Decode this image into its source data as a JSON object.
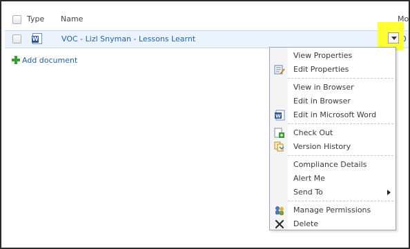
{
  "header": {
    "type_label": "Type",
    "name_label": "Name",
    "modified_label": "Mo"
  },
  "row": {
    "name": "VOC - Lizl Snyman - Lessons Learnt",
    "modified": ":0"
  },
  "add_document": "Add document",
  "accent": "#1f64a5",
  "highlight": "#ffff33",
  "menu": {
    "items": [
      {
        "label": "View Properties",
        "icon": "none"
      },
      {
        "label": "Edit Properties",
        "icon": "edit-properties-icon"
      },
      {
        "label": "View in Browser",
        "icon": "none"
      },
      {
        "label": "Edit in Browser",
        "icon": "none"
      },
      {
        "label": "Edit in Microsoft Word",
        "icon": "word-icon"
      },
      {
        "label": "Check Out",
        "icon": "check-out-icon"
      },
      {
        "label": "Version History",
        "icon": "version-history-icon"
      },
      {
        "label": "Compliance Details",
        "icon": "none"
      },
      {
        "label": "Alert Me",
        "icon": "none"
      },
      {
        "label": "Send To",
        "icon": "none",
        "submenu": true
      },
      {
        "label": "Manage Permissions",
        "icon": "manage-permissions-icon"
      },
      {
        "label": "Delete",
        "icon": "delete-icon"
      }
    ]
  }
}
